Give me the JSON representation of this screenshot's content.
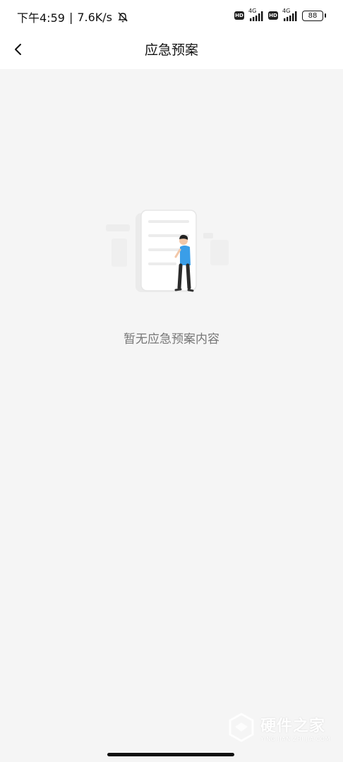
{
  "status_bar": {
    "time": "下午4:59",
    "separator": "|",
    "net_speed": "7.6K/s",
    "sim1": {
      "hd": "HD",
      "network": "4G"
    },
    "sim2": {
      "hd": "HD",
      "network": "4G"
    },
    "battery": "88"
  },
  "header": {
    "back_icon": "chevron-left-icon",
    "title": "应急预案"
  },
  "empty_state": {
    "illustration": "empty-document-person-illustration",
    "message": "暂无应急预案内容"
  },
  "watermark": {
    "cn": "硬件之家",
    "en": "YING JIAN ZHI JIA.COM"
  },
  "colors": {
    "background": "#f5f5f5",
    "header_bg": "#ffffff",
    "empty_text": "#777777",
    "person_shirt": "#3a9ee8"
  }
}
